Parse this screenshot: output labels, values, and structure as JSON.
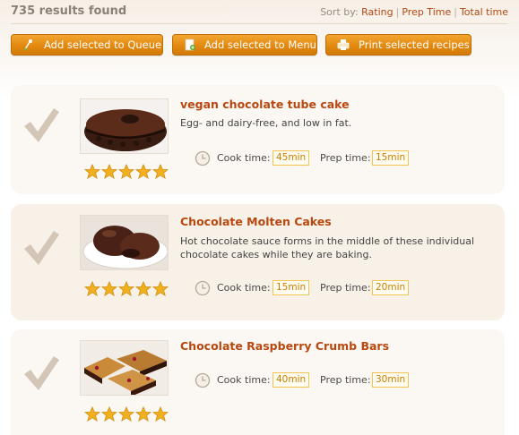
{
  "header": {
    "results_count": "735 results found",
    "sort_label": "Sort by:",
    "sort_options": [
      "Rating",
      "Prep Time",
      "Total time"
    ],
    "separator": "|"
  },
  "toolbar": {
    "add_queue_label": "Add selected to Queue",
    "add_menu_label": "Add selected to Menu",
    "print_label": "Print selected recipes"
  },
  "labels": {
    "cook_time": "Cook time:",
    "prep_time": "Prep time:"
  },
  "recipes": [
    {
      "title": "vegan chocolate tube cake",
      "description_lines": [
        "Egg- and dairy-free, and low in fat."
      ],
      "cook_time": "45min",
      "prep_time": "15min",
      "rating": 5
    },
    {
      "title": "Chocolate Molten Cakes",
      "description_lines": [
        "Hot chocolate sauce forms in the middle of these individual",
        "chocolate cakes while they are baking."
      ],
      "cook_time": "15min",
      "prep_time": "20min",
      "rating": 5
    },
    {
      "title": "Chocolate Raspberry Crumb Bars",
      "description_lines": [],
      "cook_time": "40min",
      "prep_time": "30min",
      "rating": 5
    }
  ],
  "colors": {
    "accent_orange": "#e38910",
    "link_brown": "#b8480f",
    "star_gold": "#f2b01e",
    "check_tan": "#d3c6b6"
  },
  "icons": {
    "select_check": "checkmark-icon",
    "cook_timer": "clock-icon",
    "queue": "queue-icon",
    "menu": "add-to-menu-icon",
    "print": "printer-icon",
    "rating": "star-icon"
  }
}
